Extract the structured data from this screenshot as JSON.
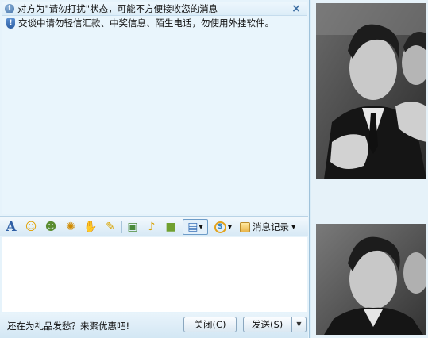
{
  "notice": {
    "dnd_message": "对方为\"请勿打扰\"状态，可能不方便接收您的消息",
    "security_message": "交谈中请勿轻信汇款、中奖信息、陌生电话，勿使用外挂软件。",
    "close_symbol": "×"
  },
  "toolbar": {
    "items": [
      {
        "name": "font",
        "glyph": "A",
        "color": "#2f5fa5"
      },
      {
        "name": "emoticon",
        "glyph": "☺",
        "color": "#e0a000"
      },
      {
        "name": "magic-emoticon",
        "glyph": "☻",
        "color": "#5a8c30"
      },
      {
        "name": "shake-window",
        "glyph": "✺",
        "color": "#d08a00"
      },
      {
        "name": "voice-message",
        "glyph": "✋",
        "color": "#d48a2a"
      },
      {
        "name": "scribble",
        "glyph": "✎",
        "color": "#d9a400"
      },
      {
        "name": "send-image",
        "glyph": "▣",
        "color": "#4a8a3a"
      },
      {
        "name": "music",
        "glyph": "♪",
        "color": "#d8a000"
      },
      {
        "name": "gift",
        "glyph": "■",
        "color": "#70a030"
      },
      {
        "name": "screenshot",
        "glyph": "▤",
        "color": "#3b72b8"
      },
      {
        "name": "payment",
        "glyph": "S",
        "color": "#2f7fc0"
      }
    ],
    "history_label": "消息记录"
  },
  "bottom": {
    "promo_text": "还在为礼品发愁？来聚优惠吧!",
    "close_label": "关闭(C)",
    "send_label": "发送(S)",
    "dropdown_symbol": "▼"
  },
  "colors": {
    "accent": "#3e6fa3",
    "chat_bg": "#e6f3fb",
    "input_bg": "#ffffff"
  }
}
